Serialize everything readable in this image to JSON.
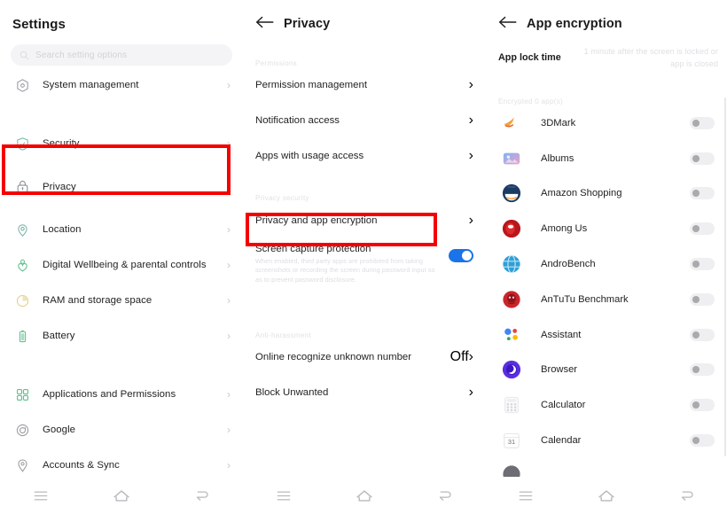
{
  "panels": {
    "settings": {
      "title": "Settings",
      "search": {
        "placeholder": "Search setting options",
        "icon": "search-icon"
      },
      "items": [
        {
          "label": "System management",
          "icon": "system-management-icon",
          "chevron": "›"
        },
        {
          "label": "Security",
          "icon": "shield-check-icon",
          "chevron": "›"
        },
        {
          "label": "Privacy",
          "icon": "lock-icon",
          "chevron": "›"
        },
        {
          "label": "Location",
          "icon": "location-pin-icon",
          "chevron": "›"
        },
        {
          "label": "Digital Wellbeing & parental controls",
          "icon": "wellbeing-icon",
          "chevron": "›"
        },
        {
          "label": "RAM and storage space",
          "icon": "pie-chart-icon",
          "chevron": "›"
        },
        {
          "label": "Battery",
          "icon": "battery-icon",
          "chevron": "›"
        },
        {
          "label": "Applications and Permissions",
          "icon": "apps-grid-icon",
          "chevron": "›"
        },
        {
          "label": "Google",
          "icon": "google-icon",
          "chevron": "›"
        },
        {
          "label": "Accounts & Sync",
          "icon": "account-key-icon",
          "chevron": "›"
        }
      ]
    },
    "privacy": {
      "title": "Privacy",
      "back_icon": "back-arrow-icon",
      "section_permissions": "Permissions",
      "permission_items": [
        {
          "label": "Permission management",
          "chevron": "›"
        },
        {
          "label": "Notification access",
          "chevron": "›"
        },
        {
          "label": "Apps with usage access",
          "chevron": "›"
        }
      ],
      "section_privacy_security": "Privacy security",
      "privacy_security_items": [
        {
          "label": "Privacy and app encryption",
          "chevron": "›"
        }
      ],
      "screen_capture": {
        "title": "Screen capture protection",
        "description": "When enabled, third party apps are prohibited from taking screenshots or recording the screen during password input so as to prevent password disclosure.",
        "toggle_state": "on"
      },
      "section_anti_harassment": "Anti-harassment",
      "anti_harassment_items": [
        {
          "label": "Online recognize unknown number",
          "value": "Off",
          "chevron": "›"
        },
        {
          "label": "Block Unwanted",
          "value": "",
          "chevron": "›"
        }
      ]
    },
    "app_encryption": {
      "title": "App encryption",
      "back_icon": "back-arrow-icon",
      "lock_time_label": "App lock time",
      "lock_time_value": "1 minute after the screen is locked or app is closed",
      "section_encrypted": "Encrypted 0 app(s)",
      "apps": [
        {
          "name": "3DMark",
          "icon": "3dmark-icon",
          "toggle": "off"
        },
        {
          "name": "Albums",
          "icon": "albums-icon",
          "toggle": "off"
        },
        {
          "name": "Amazon Shopping",
          "icon": "amazon-shopping-icon",
          "toggle": "off"
        },
        {
          "name": "Among Us",
          "icon": "among-us-icon",
          "toggle": "off"
        },
        {
          "name": "AndroBench",
          "icon": "androbench-icon",
          "toggle": "off"
        },
        {
          "name": "AnTuTu Benchmark",
          "icon": "antutu-icon",
          "toggle": "off"
        },
        {
          "name": "Assistant",
          "icon": "google-assistant-icon",
          "toggle": "off"
        },
        {
          "name": "Browser",
          "icon": "browser-icon",
          "toggle": "off"
        },
        {
          "name": "Calculator",
          "icon": "calculator-icon",
          "toggle": "off"
        },
        {
          "name": "Calendar",
          "icon": "calendar-icon",
          "toggle": "off"
        }
      ]
    }
  },
  "navbar": {
    "recents": "☰",
    "home": "home-icon",
    "back": "back-nav-icon"
  },
  "highlights": [
    {
      "name": "privacy-row-highlight",
      "color": "#f50000"
    },
    {
      "name": "privacy-and-app-encryption-highlight",
      "color": "#f50000"
    }
  ],
  "colors": {
    "accent": "#1a73e8",
    "highlight": "#f50000",
    "text": "#232323",
    "muted": "#dddde2"
  }
}
